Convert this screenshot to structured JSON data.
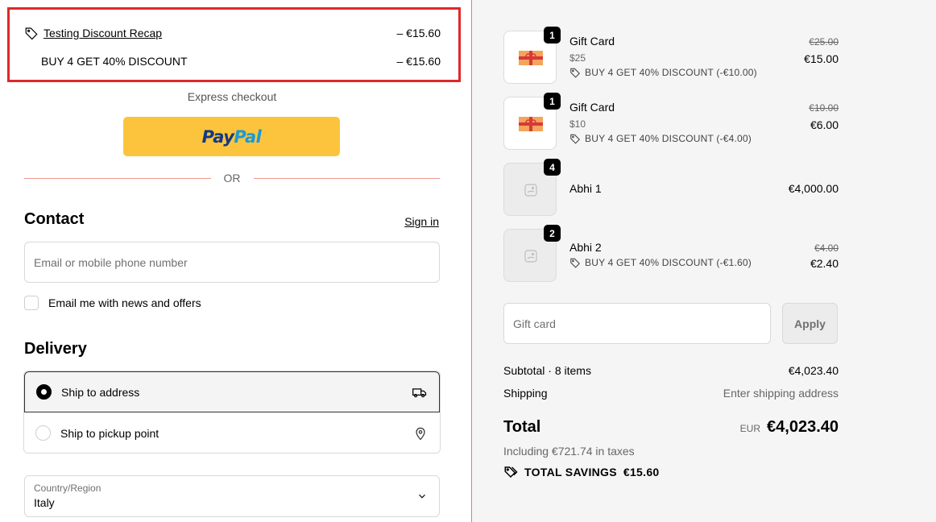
{
  "discount_recap": {
    "title": "Testing Discount Recap",
    "title_amount": "– €15.60",
    "line_label": "BUY 4 GET 40% DISCOUNT",
    "line_amount": "– €15.60"
  },
  "express": {
    "label": "Express checkout",
    "paypal_a": "Pay",
    "paypal_b": "Pal",
    "or_label": "OR"
  },
  "contact": {
    "heading": "Contact",
    "sign_in": "Sign in",
    "email_placeholder": "Email or mobile phone number",
    "news_label": "Email me with news and offers"
  },
  "delivery": {
    "heading": "Delivery",
    "options": [
      {
        "label": "Ship to address",
        "selected": true,
        "icon": "truck-icon"
      },
      {
        "label": "Ship to pickup point",
        "selected": false,
        "icon": "map-pin-icon"
      }
    ],
    "country_label": "Country/Region",
    "country_value": "Italy"
  },
  "cart": {
    "items": [
      {
        "name": "Gift Card",
        "variant": "$25",
        "discount": "BUY 4 GET 40% DISCOUNT (-€10.00)",
        "old_price": "€25.00",
        "price": "€15.00",
        "qty": "1",
        "image": "gift-card-image"
      },
      {
        "name": "Gift Card",
        "variant": "$10",
        "discount": "BUY 4 GET 40% DISCOUNT (-€4.00)",
        "old_price": "€10.00",
        "price": "€6.00",
        "qty": "1",
        "image": "gift-card-image"
      },
      {
        "name": "Abhi 1",
        "price": "€4,000.00",
        "qty": "4",
        "image": "placeholder-image"
      },
      {
        "name": "Abhi 2",
        "discount": "BUY 4 GET 40% DISCOUNT (-€1.60)",
        "old_price": "€4.00",
        "price": "€2.40",
        "qty": "2",
        "image": "placeholder-image"
      }
    ],
    "gift_card_placeholder": "Gift card",
    "apply_label": "Apply"
  },
  "summary": {
    "subtotal_label": "Subtotal · 8 items",
    "subtotal_value": "€4,023.40",
    "shipping_label": "Shipping",
    "shipping_value": "Enter shipping address",
    "total_label": "Total",
    "currency": "EUR",
    "total_value": "€4,023.40",
    "taxes": "Including €721.74 in taxes",
    "savings_label": "TOTAL SAVINGS",
    "savings_value": "€15.60"
  },
  "colors": {
    "paypal_button": "#fcc43d",
    "paypal_dark": "#113984",
    "paypal_light": "#179bd7",
    "highlight_border": "#e0282a"
  }
}
